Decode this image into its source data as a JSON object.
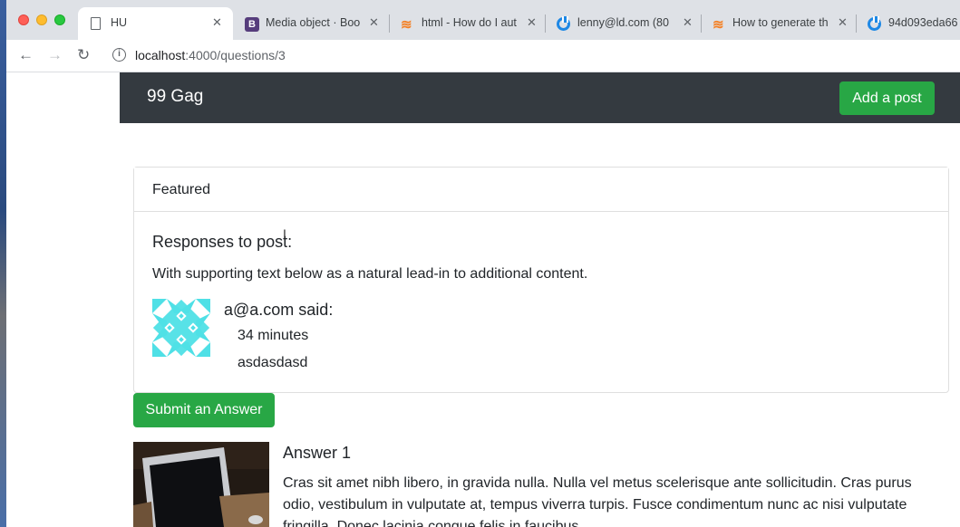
{
  "browser": {
    "tabs": [
      {
        "title": "HU",
        "close": "✕"
      },
      {
        "title": "Media object · Boo",
        "close": "✕"
      },
      {
        "title": "html - How do I aut",
        "close": "✕"
      },
      {
        "title": "lenny@ld.com (80",
        "close": "✕"
      },
      {
        "title": "How to generate th",
        "close": "✕"
      },
      {
        "title": "94d093eda66",
        "close": ""
      }
    ],
    "url_host": "localhost",
    "url_path": ":4000/questions/3",
    "url_info_icon": "i",
    "back_icon": "←",
    "forward_icon": "→",
    "reload_icon": "↻"
  },
  "navbar": {
    "brand": "99 Gag",
    "add_post": "Add a post"
  },
  "card": {
    "header": "Featured",
    "title": "Responses to post:",
    "text": "With supporting text below as a natural lead-in to additional content.",
    "response": {
      "author_line": "a@a.com said:",
      "time": "34 minutes",
      "body": "asdasdasd"
    }
  },
  "submit_label": "Submit an Answer",
  "answer": {
    "title": "Answer 1",
    "body": "Cras sit amet nibh libero, in gravida nulla. Nulla vel metus scelerisque ante sollicitudin. Cras purus odio, vestibulum in vulputate at, tempus viverra turpis. Fusce condimentum nunc ac nisi vulputate fringilla. Donec lacinia congue felis in faucibus."
  },
  "colors": {
    "navbar": "#343a40",
    "success": "#28a745",
    "avatar": "#4fe0e6"
  }
}
